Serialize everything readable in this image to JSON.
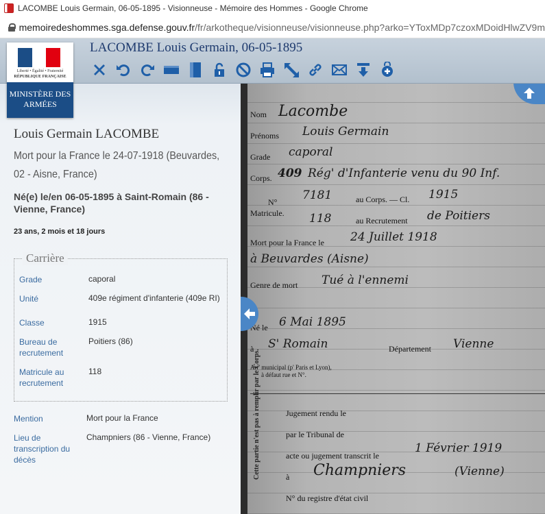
{
  "window": {
    "title": "LACOMBE Louis Germain, 06-05-1895 - Visionneuse - Mémoire des Hommes - Google Chrome"
  },
  "address": {
    "host": "memoiredeshommes.sga.defense.gouv.fr",
    "path": "/fr/arkotheque/visionneuse/visionneuse.php?arko=YToxMDp7czoxMDoidHlwZV9m"
  },
  "header": {
    "title": "LACOMBE Louis Germain, 06-05-1895",
    "tools": [
      "close-icon",
      "rotate-left-icon",
      "rotate-right-icon",
      "fit-width-icon",
      "fit-height-icon",
      "lock-icon",
      "forbidden-icon",
      "print-icon",
      "fullscreen-icon",
      "link-icon",
      "mail-icon",
      "download-icon",
      "add-icon"
    ]
  },
  "logo": {
    "marianne_line1": "Liberté • Égalité • Fraternité",
    "marianne_line2": "RÉPUBLIQUE FRANÇAISE",
    "ministry": "MINISTÈRE DES ARMÉES"
  },
  "person": {
    "name": "Louis Germain LACOMBE",
    "death": "Mort pour la France le 24-07-1918 (Beuvardes, 02 - Aisne, France)",
    "birth": "Né(e) le/en 06-05-1895 à Saint-Romain (86 - Vienne, France)",
    "age": "23 ans, 2 mois et 18 jours"
  },
  "career": {
    "legend": "Carrière",
    "rows": [
      {
        "key": "Grade",
        "value": "caporal"
      },
      {
        "key": "Unité",
        "value": "409e régiment d'infanterie (409e RI)"
      },
      {
        "key": "Classe",
        "value": "1915"
      },
      {
        "key": "Bureau de recrutement",
        "value": "Poitiers (86)"
      },
      {
        "key": "Matricule au recrutement",
        "value": "118"
      }
    ]
  },
  "mention": {
    "rows": [
      {
        "key": "Mention",
        "value": "Mort pour la France"
      },
      {
        "key": "Lieu de transcription du décès",
        "value": "Champniers (86 - Vienne, France)"
      }
    ]
  },
  "document": {
    "labels": {
      "nom": "Nom",
      "prenoms": "Prénoms",
      "grade": "Grade",
      "corps": "Corps.",
      "no": "N°",
      "matricule": "Matricule.",
      "au_corps": "au Corps. — Cl.",
      "au_recrutement": "au Recrutement",
      "mort": "Mort pour la France le",
      "genre": "Genre de mort",
      "ne": "Né le",
      "a": "à",
      "departement": "Département",
      "arr": "Arr' municipal (p' Paris et Lyon),",
      "arr2": "à défaut rue et N°.",
      "jugement": "Jugement rendu le",
      "tribunal": "par le Tribunal de",
      "acte": "acte ou jugement transcrit le",
      "a2": "à",
      "registre": "N° du registre d'état civil",
      "side": "Cette partie n'est pas à remplir par le Corps."
    },
    "handwriting": {
      "nom": "Lacombe",
      "prenoms": "Louis Germain",
      "grade": "caporal",
      "corps_no": "409",
      "corps": "Rég' d'Infanterie venu du 90 Inf.",
      "no_corps": "7181",
      "classe": "1915",
      "no_rec": "118",
      "recrutement": "de Poitiers",
      "mort_date": "24 Juillet 1918",
      "lieu_mort": "à Beuvardes (Aisne)",
      "genre": "Tué à l'ennemi",
      "ne_date": "6 Mai 1895",
      "ne_lieu": "S' Romain",
      "departement": "Vienne",
      "transcrit": "1 Février 1919",
      "transcrit_lieu": "Champniers",
      "transcrit_dep": "(Vienne)"
    }
  }
}
